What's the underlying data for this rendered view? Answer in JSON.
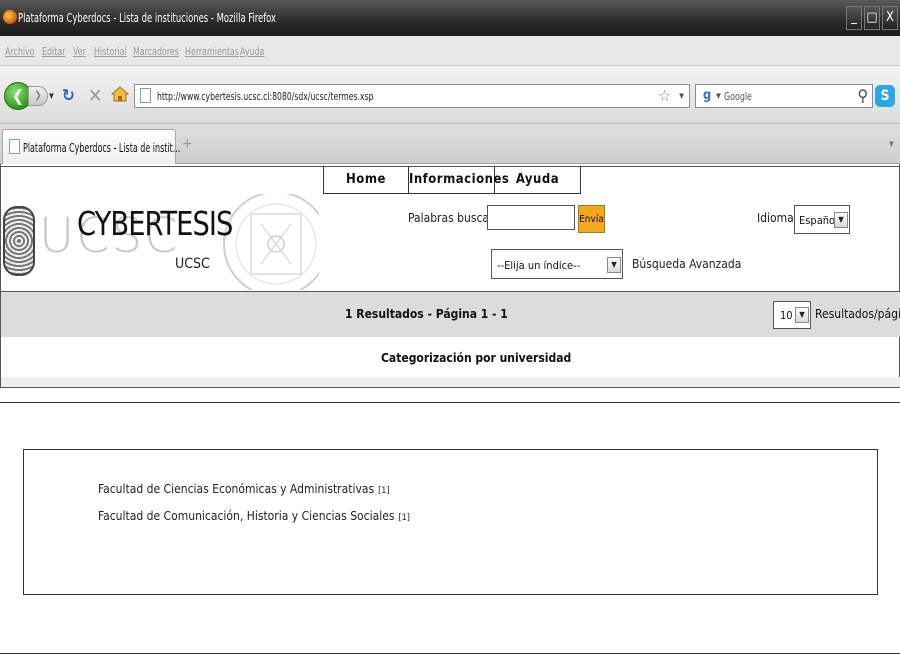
{
  "window": {
    "title": "Plataforma Cyberdocs - Lista de instituciones - Mozilla Firefox",
    "controls": [
      "_",
      "□",
      "X"
    ]
  },
  "menu": [
    "Archivo",
    "Editar",
    "Ver",
    "Historial",
    "Marcadores",
    "Herramientas",
    "Ayuda"
  ],
  "nav": {
    "url": "http://www.cybertesis.ucsc.cl:8080/sdx/ucsc/termes.xsp",
    "search_engine": "Google"
  },
  "tab": {
    "label": "Plataforma Cyberdocs - Lista de instit...",
    "new_tab": "+"
  },
  "site": {
    "nav_links": [
      "Home",
      "Informaciones",
      "Ayuda"
    ],
    "logo": {
      "main": "CYBERTESIS",
      "sub": "UCSC",
      "watermark": "UCSC"
    },
    "search_label": "Palabras buscadas",
    "search_value": "",
    "search_button": "Envía",
    "idioma_label": "Idioma :",
    "idioma_value": "Español",
    "indice_value": "--Elija un índice--",
    "advanced_label": "Búsqueda Avanzada",
    "results_text": "1 Resultados - Página 1 - 1",
    "per_page_value": "10",
    "per_page_label": "Resultados/página",
    "category_title": "Categorización por universidad",
    "items": [
      {
        "label": "Facultad de Ciencias Económicas y Administrativas",
        "count": "[1]"
      },
      {
        "label": "Facultad de Comunicación, Historia y Ciencias Sociales",
        "count": "[1]"
      }
    ]
  },
  "colors": {
    "envia_button": "#f2a71d",
    "results_bar": "#dcdcdc",
    "titlebar": "#2a2a2a"
  }
}
